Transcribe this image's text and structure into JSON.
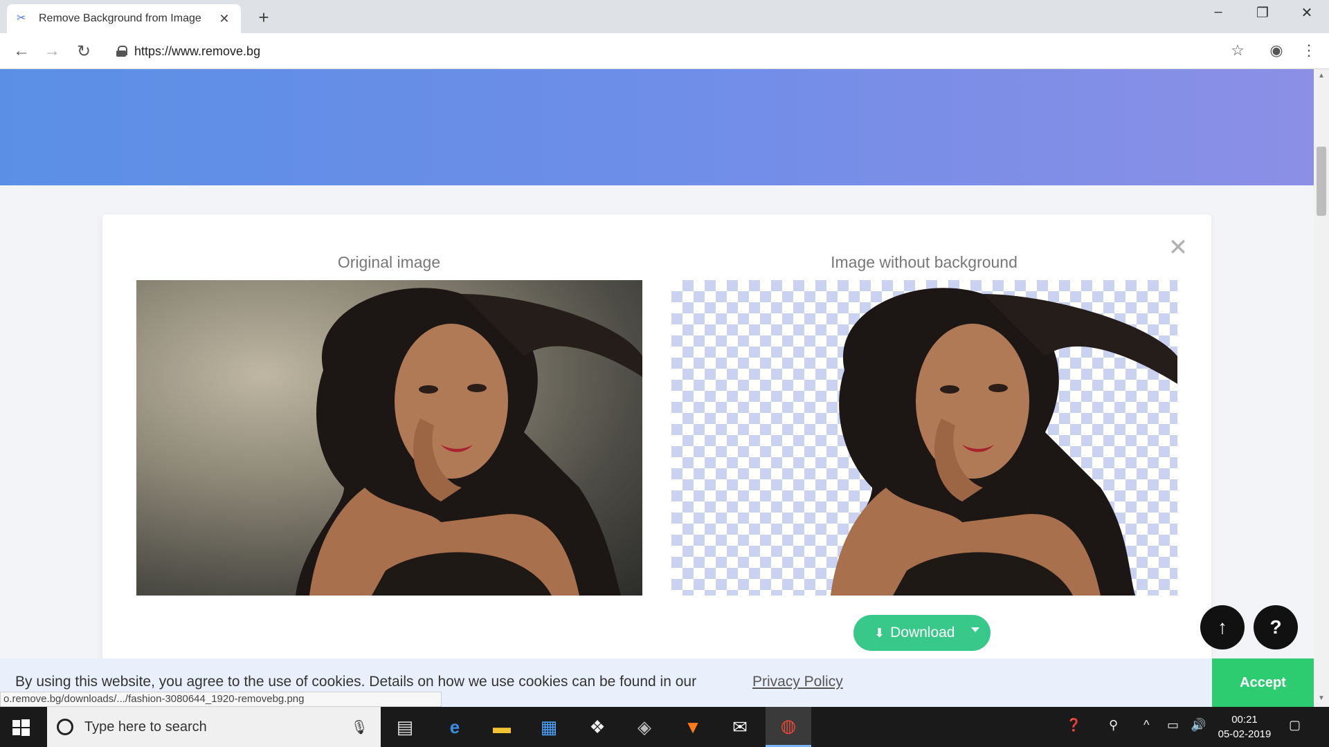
{
  "browser": {
    "tab_title": "Remove Background from Image",
    "url": "https://www.remove.bg",
    "status_url": "o.remove.bg/downloads/.../fashion-3080644_1920-removebg.png"
  },
  "result": {
    "original_label": "Original image",
    "no_bg_label": "Image without background",
    "download_label": "Download"
  },
  "floating": {
    "up_icon": "↑",
    "help_icon": "?"
  },
  "cookie": {
    "text": "By using this website, you agree to the use of cookies. Details on how we use cookies can be found in our",
    "link": "Privacy Policy",
    "accept": "Accept"
  },
  "taskbar": {
    "search_placeholder": "Type here to search",
    "time": "00:21",
    "date": "05-02-2019"
  },
  "colors": {
    "hero": "#6e8ee8",
    "download": "#38c98a",
    "accept": "#2ecc71"
  }
}
